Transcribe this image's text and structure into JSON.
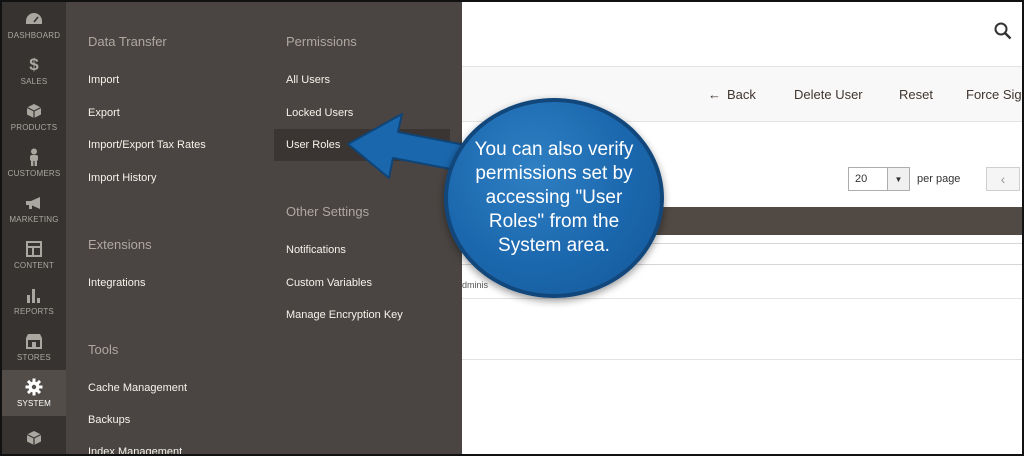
{
  "sidebar": {
    "items": [
      {
        "label": "DASHBOARD",
        "icon": "dashboard-icon"
      },
      {
        "label": "SALES",
        "icon": "dollar-icon"
      },
      {
        "label": "PRODUCTS",
        "icon": "cube-icon"
      },
      {
        "label": "CUSTOMERS",
        "icon": "person-icon"
      },
      {
        "label": "MARKETING",
        "icon": "megaphone-icon"
      },
      {
        "label": "CONTENT",
        "icon": "layout-icon"
      },
      {
        "label": "REPORTS",
        "icon": "bar-chart-icon"
      },
      {
        "label": "STORES",
        "icon": "store-icon"
      },
      {
        "label": "SYSTEM",
        "icon": "gear-icon",
        "active": true
      },
      {
        "label": "",
        "icon": "box-icon"
      }
    ]
  },
  "menu": {
    "data_transfer": {
      "title": "Data Transfer",
      "links": [
        "Import",
        "Export",
        "Import/Export Tax Rates",
        "Import History"
      ]
    },
    "extensions": {
      "title": "Extensions",
      "links": [
        "Integrations"
      ]
    },
    "tools": {
      "title": "Tools",
      "links": [
        "Cache Management",
        "Backups",
        "Index Management"
      ]
    },
    "permissions": {
      "title": "Permissions",
      "links": [
        "All Users",
        "Locked Users",
        "User Roles"
      ]
    },
    "other_settings": {
      "title": "Other Settings",
      "links": [
        "Notifications",
        "Custom Variables",
        "Manage Encryption Key"
      ]
    }
  },
  "toolbar": {
    "back": "Back",
    "delete_user": "Delete User",
    "reset": "Reset",
    "force_sign": "Force Sign"
  },
  "grid": {
    "per_page_value": "20",
    "per_page_label": "per page",
    "cell_partial": "dminis"
  },
  "callout": {
    "text": "You can also verify permissions set by accessing \"User Roles\" from the System area."
  },
  "colors": {
    "sidebar_bg": "#373330",
    "flyout_bg": "#4a4542",
    "callout_blue": "#1b67ad",
    "header_bar": "#514943"
  }
}
